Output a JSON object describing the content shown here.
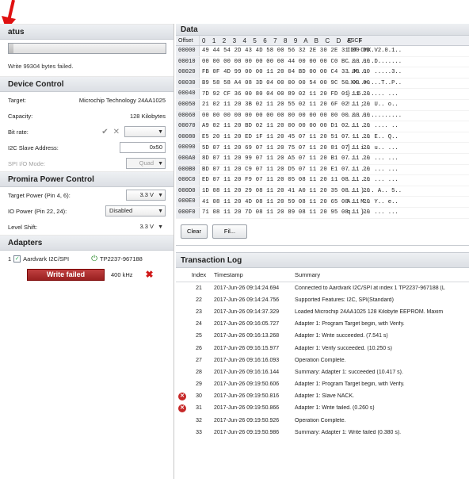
{
  "colors": {
    "annotation_arrow": "#e01010",
    "fail_button": "#a82828",
    "error_icon": "#c62828"
  },
  "status": {
    "header": "atus",
    "progress_percent": 3,
    "message": "Write 99304 bytes failed."
  },
  "device_control": {
    "header": "Device Control",
    "target_label": "Target:",
    "target_value": "Microchip Technology 24AA1025",
    "capacity_label": "Capacity:",
    "capacity_value": "128 Kilobytes",
    "bitrate_label": "Bit rate:",
    "bitrate_value": "",
    "slave_label": "I2C Slave Address:",
    "slave_value": "0x50",
    "spi_label": "SPI I/O Mode:",
    "spi_value": "Quad"
  },
  "power_control": {
    "header": "Promira Power Control",
    "target_power_label": "Target Power (Pin 4, 6):",
    "target_power_value": "3.3 V",
    "io_power_label": "IO Power (Pin 22, 24):",
    "io_power_value": "Disabled",
    "level_shift_label": "Level Shift:",
    "level_shift_value": "3.3 V"
  },
  "adapters": {
    "header": "Adapters",
    "index": "1",
    "name": "Aardvark I2C/SPI",
    "serial": "TP2237-967188",
    "status_label": "Write failed",
    "frequency": "400 kHz"
  },
  "data_panel": {
    "header": "Data",
    "offset_label": "Offset",
    "columns": "0 1 2 3 4 5 6 7 8 9 A B C D E F",
    "ascii_label": "ASCII",
    "rows": [
      {
        "offset": "00000",
        "bytes": "49 44 54 2D 43 4D 58 00 56 32 2E 30 2E 31 00 00",
        "ascii": "IDT-CMX.V2.0.1.."
      },
      {
        "offset": "00010",
        "bytes": "00 00 00 00 00 00 00 00 44 00 00 00 C0 BC 00 00",
        "ascii": "........D......."
      },
      {
        "offset": "00020",
        "bytes": "FB 0F 4D 99 00 00 11 20 04 BD 00 00 C4 33 00 00",
        "ascii": "..M...  .....3.."
      },
      {
        "offset": "00030",
        "bytes": "B9 58 58 A4 08 3D 04 00 00 00 54 00 9C 50 00 00",
        "ascii": ".XX..=....T..P.."
      },
      {
        "offset": "00040",
        "bytes": "7D 92 CF 36 00 80 04 00 89 02 11 20 FD 01 11 20",
        "ascii": "}..6....... ... "
      },
      {
        "offset": "00050",
        "bytes": "21 02 11 20 3B 02 11 20 55 02 11 20 6F 02 11 20",
        "ascii": "!.. ;.. U.. o.. "
      },
      {
        "offset": "00060",
        "bytes": "00 00 00 00 00 00 00 00 00 00 00 00 00 00 00 00",
        "ascii": "................"
      },
      {
        "offset": "00070",
        "bytes": "A9 02 11 20 BD 02 11 20 00 00 00 00 D1 02 11 20",
        "ascii": "... ... .... .. "
      },
      {
        "offset": "00080",
        "bytes": "E5 20 11 20 ED 1F 11 20 45 07 11 20 51 07 11 20",
        "ascii": ". . ... E.. Q.. "
      },
      {
        "offset": "00090",
        "bytes": "5D 07 11 20 69 07 11 20 75 07 11 20 81 07 11 20",
        "ascii": "].. i.. u.. ... "
      },
      {
        "offset": "000A0",
        "bytes": "8D 07 11 20 99 07 11 20 A5 07 11 20 B1 07 11 20",
        "ascii": "... ... ... ... "
      },
      {
        "offset": "000B0",
        "bytes": "BD 07 11 20 C9 07 11 20 D5 07 11 20 E1 07 11 20",
        "ascii": "... ... ... ... "
      },
      {
        "offset": "000C0",
        "bytes": "ED 07 11 20 F9 07 11 20 05 08 11 20 11 08 11 20",
        "ascii": "... ... ... ... "
      },
      {
        "offset": "000D0",
        "bytes": "1D 08 11 20 29 08 11 20 41 A0 11 20 35 08 11 20",
        "ascii": "... )... A.. 5.. "
      },
      {
        "offset": "000E0",
        "bytes": "41 08 11 20 4D 08 11 20 59 08 11 20 65 08 11 20",
        "ascii": "A.. M.. Y.. e.. "
      },
      {
        "offset": "000F0",
        "bytes": "71 08 11 20 7D 08 11 20 89 08 11 20 95 08 11 20",
        "ascii": "q.. }.. ... ... "
      }
    ],
    "clear_button": "Clear",
    "fill_button": "Fil..."
  },
  "transaction_log": {
    "header": "Transaction Log",
    "col_index": "Index",
    "col_timestamp": "Timestamp",
    "col_summary": "Summary",
    "rows": [
      {
        "error": false,
        "index": "21",
        "timestamp": "2017-Jun-26 09:14:24.694",
        "summary": "Connected to Aardvark I2C/SPI at index 1 TP2237-967188 (L"
      },
      {
        "error": false,
        "index": "22",
        "timestamp": "2017-Jun-26 09:14:24.756",
        "summary": "Supported Features: I2C, SPI(Standard)"
      },
      {
        "error": false,
        "index": "23",
        "timestamp": "2017-Jun-26 09:14:37.329",
        "summary": "Loaded Microchip 24AA1025 128 Kilobyte EEPROM. Maxim"
      },
      {
        "error": false,
        "index": "24",
        "timestamp": "2017-Jun-26 09:16:05.727",
        "summary": "Adapter 1: Program Target begin, with Verify."
      },
      {
        "error": false,
        "index": "25",
        "timestamp": "2017-Jun-26 09:16:13.268",
        "summary": "Adapter 1: Write succeeded. (7.541 s)"
      },
      {
        "error": false,
        "index": "26",
        "timestamp": "2017-Jun-26 09:16:15.977",
        "summary": "Adapter 1: Verify succeeded. (10.250 s)"
      },
      {
        "error": false,
        "index": "27",
        "timestamp": "2017-Jun-26 09:16:16.093",
        "summary": "Operation Complete."
      },
      {
        "error": false,
        "index": "28",
        "timestamp": "2017-Jun-26 09:16:16.144",
        "summary": "Summary: Adapter 1: succeeded (10.417 s)."
      },
      {
        "error": false,
        "index": "29",
        "timestamp": "2017-Jun-26 09:19:50.606",
        "summary": "Adapter 1: Program Target begin, with Verify."
      },
      {
        "error": true,
        "index": "30",
        "timestamp": "2017-Jun-26 09:19:50.816",
        "summary": "Adapter 1: Slave NACK."
      },
      {
        "error": true,
        "index": "31",
        "timestamp": "2017-Jun-26 09:19:50.866",
        "summary": "Adapter 1: Write failed. (0.260 s)"
      },
      {
        "error": false,
        "index": "32",
        "timestamp": "2017-Jun-26 09:19:50.926",
        "summary": "Operation Complete."
      },
      {
        "error": false,
        "index": "33",
        "timestamp": "2017-Jun-26 09:19:50.986",
        "summary": "Summary: Adapter 1: Write failed (0.380 s)."
      }
    ]
  }
}
